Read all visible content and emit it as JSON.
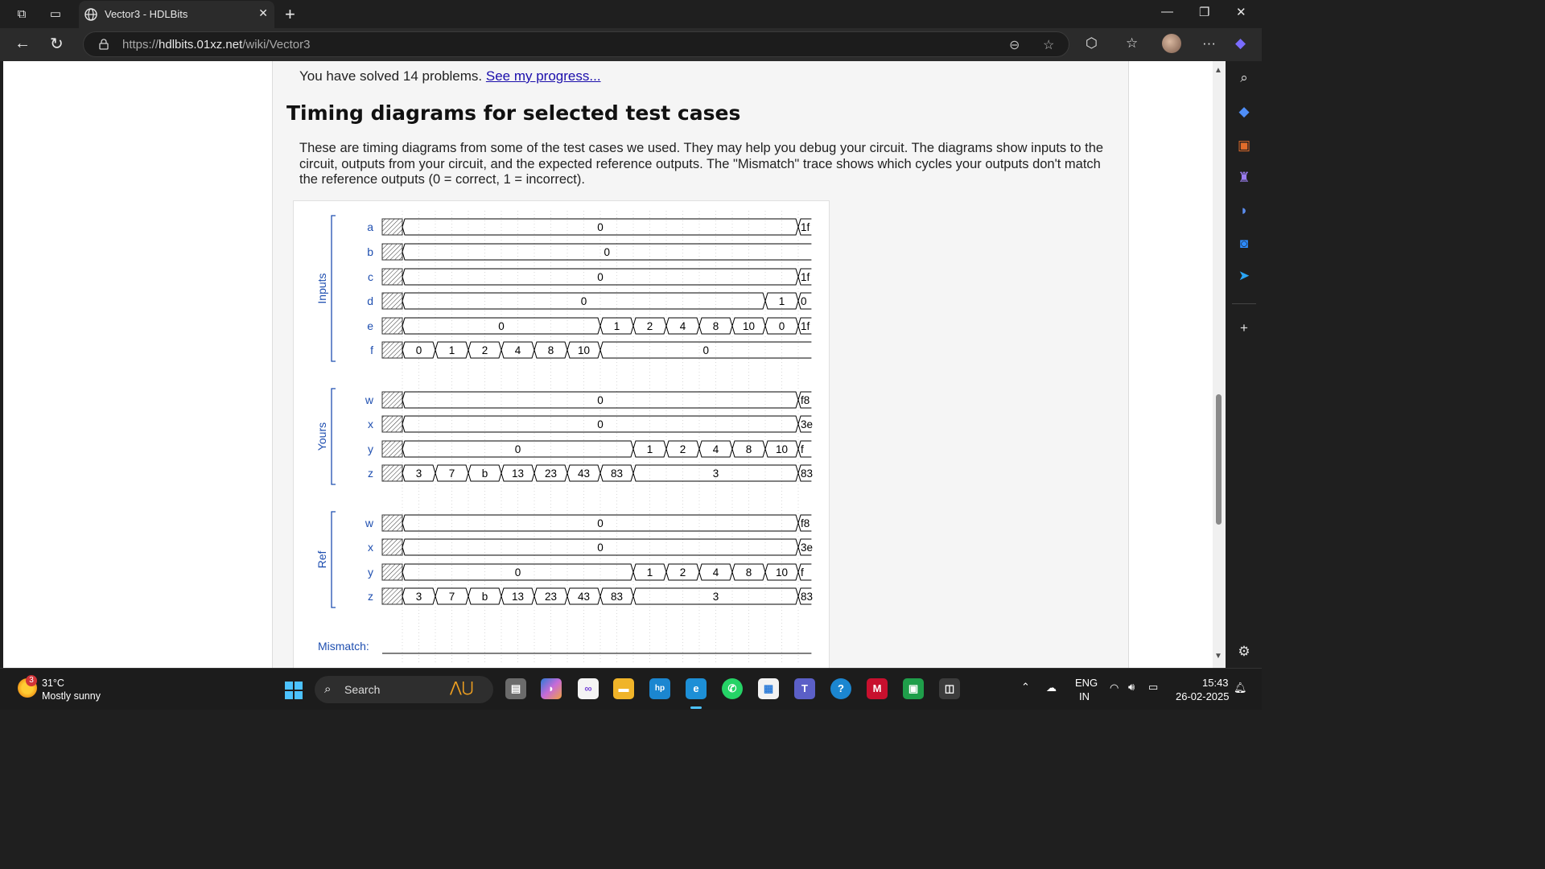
{
  "browser": {
    "tab_title": "Vector3 - HDLBits",
    "url_prefix": "https://",
    "url_host": "hdlbits.01xz.net",
    "url_path": "/wiki/Vector3"
  },
  "page": {
    "solved_text": "You have solved 14 problems.",
    "progress_link": "See my progress...",
    "heading": "Timing diagrams for selected test cases",
    "description": "These are timing diagrams from some of the test cases we used. They may help you debug your circuit. The diagrams show inputs to the circuit, outputs from your circuit, and the expected reference outputs. The \"Mismatch\" trace shows which cycles your outputs don't match the reference outputs (0 = correct, 1 = incorrect)."
  },
  "waveform": {
    "groups": [
      {
        "label": "Inputs",
        "signals": [
          {
            "name": "a",
            "segments": [
              {
                "v": "0",
                "s": 0,
                "e": 12
              },
              {
                "v": "1f",
                "s": 12,
                "e": 12.4
              }
            ]
          },
          {
            "name": "b",
            "segments": [
              {
                "v": "0",
                "s": 0,
                "e": 12.4
              }
            ]
          },
          {
            "name": "c",
            "segments": [
              {
                "v": "0",
                "s": 0,
                "e": 12
              },
              {
                "v": "1f",
                "s": 12,
                "e": 12.4
              }
            ]
          },
          {
            "name": "d",
            "segments": [
              {
                "v": "0",
                "s": 0,
                "e": 11
              },
              {
                "v": "1",
                "s": 11,
                "e": 12
              },
              {
                "v": "0",
                "s": 12,
                "e": 12.4
              }
            ]
          },
          {
            "name": "e",
            "segments": [
              {
                "v": "0",
                "s": 0,
                "e": 6
              },
              {
                "v": "1",
                "s": 6,
                "e": 7
              },
              {
                "v": "2",
                "s": 7,
                "e": 8
              },
              {
                "v": "4",
                "s": 8,
                "e": 9
              },
              {
                "v": "8",
                "s": 9,
                "e": 10
              },
              {
                "v": "10",
                "s": 10,
                "e": 11
              },
              {
                "v": "0",
                "s": 11,
                "e": 12
              },
              {
                "v": "1f",
                "s": 12,
                "e": 12.4
              }
            ]
          },
          {
            "name": "f",
            "segments": [
              {
                "v": "0",
                "s": 0,
                "e": 1
              },
              {
                "v": "1",
                "s": 1,
                "e": 2
              },
              {
                "v": "2",
                "s": 2,
                "e": 3
              },
              {
                "v": "4",
                "s": 3,
                "e": 4
              },
              {
                "v": "8",
                "s": 4,
                "e": 5
              },
              {
                "v": "10",
                "s": 5,
                "e": 6
              },
              {
                "v": "0",
                "s": 6,
                "e": 12.4
              }
            ]
          }
        ]
      },
      {
        "label": "Yours",
        "signals": [
          {
            "name": "w",
            "segments": [
              {
                "v": "0",
                "s": 0,
                "e": 12
              },
              {
                "v": "f8",
                "s": 12,
                "e": 12.4
              }
            ]
          },
          {
            "name": "x",
            "segments": [
              {
                "v": "0",
                "s": 0,
                "e": 12
              },
              {
                "v": "3e",
                "s": 12,
                "e": 12.4
              }
            ]
          },
          {
            "name": "y",
            "segments": [
              {
                "v": "0",
                "s": 0,
                "e": 7
              },
              {
                "v": "1",
                "s": 7,
                "e": 8
              },
              {
                "v": "2",
                "s": 8,
                "e": 9
              },
              {
                "v": "4",
                "s": 9,
                "e": 10
              },
              {
                "v": "8",
                "s": 10,
                "e": 11
              },
              {
                "v": "10",
                "s": 11,
                "e": 12
              },
              {
                "v": "f",
                "s": 12,
                "e": 12.4
              }
            ]
          },
          {
            "name": "z",
            "segments": [
              {
                "v": "3",
                "s": 0,
                "e": 1
              },
              {
                "v": "7",
                "s": 1,
                "e": 2
              },
              {
                "v": "b",
                "s": 2,
                "e": 3
              },
              {
                "v": "13",
                "s": 3,
                "e": 4
              },
              {
                "v": "23",
                "s": 4,
                "e": 5
              },
              {
                "v": "43",
                "s": 5,
                "e": 6
              },
              {
                "v": "83",
                "s": 6,
                "e": 7
              },
              {
                "v": "3",
                "s": 7,
                "e": 12
              },
              {
                "v": "83",
                "s": 12,
                "e": 12.4
              }
            ]
          }
        ]
      },
      {
        "label": "Ref",
        "signals": [
          {
            "name": "w",
            "segments": [
              {
                "v": "0",
                "s": 0,
                "e": 12
              },
              {
                "v": "f8",
                "s": 12,
                "e": 12.4
              }
            ]
          },
          {
            "name": "x",
            "segments": [
              {
                "v": "0",
                "s": 0,
                "e": 12
              },
              {
                "v": "3e",
                "s": 12,
                "e": 12.4
              }
            ]
          },
          {
            "name": "y",
            "segments": [
              {
                "v": "0",
                "s": 0,
                "e": 7
              },
              {
                "v": "1",
                "s": 7,
                "e": 8
              },
              {
                "v": "2",
                "s": 8,
                "e": 9
              },
              {
                "v": "4",
                "s": 9,
                "e": 10
              },
              {
                "v": "8",
                "s": 10,
                "e": 11
              },
              {
                "v": "10",
                "s": 11,
                "e": 12
              },
              {
                "v": "f",
                "s": 12,
                "e": 12.4
              }
            ]
          },
          {
            "name": "z",
            "segments": [
              {
                "v": "3",
                "s": 0,
                "e": 1
              },
              {
                "v": "7",
                "s": 1,
                "e": 2
              },
              {
                "v": "b",
                "s": 2,
                "e": 3
              },
              {
                "v": "13",
                "s": 3,
                "e": 4
              },
              {
                "v": "23",
                "s": 4,
                "e": 5
              },
              {
                "v": "43",
                "s": 5,
                "e": 6
              },
              {
                "v": "83",
                "s": 6,
                "e": 7
              },
              {
                "v": "3",
                "s": 7,
                "e": 12
              },
              {
                "v": "83",
                "s": 12,
                "e": 12.4
              }
            ]
          }
        ]
      }
    ],
    "mismatch_label": "Mismatch:",
    "label_color": "#1f4fb0",
    "signal_color": "#000000"
  },
  "taskbar": {
    "weather_temp": "31°C",
    "weather_desc": "Mostly sunny",
    "weather_badge": "3",
    "search_placeholder": "Search",
    "language_line1": "ENG",
    "language_line2": "IN",
    "time": "15:43",
    "date": "26-02-2025"
  }
}
